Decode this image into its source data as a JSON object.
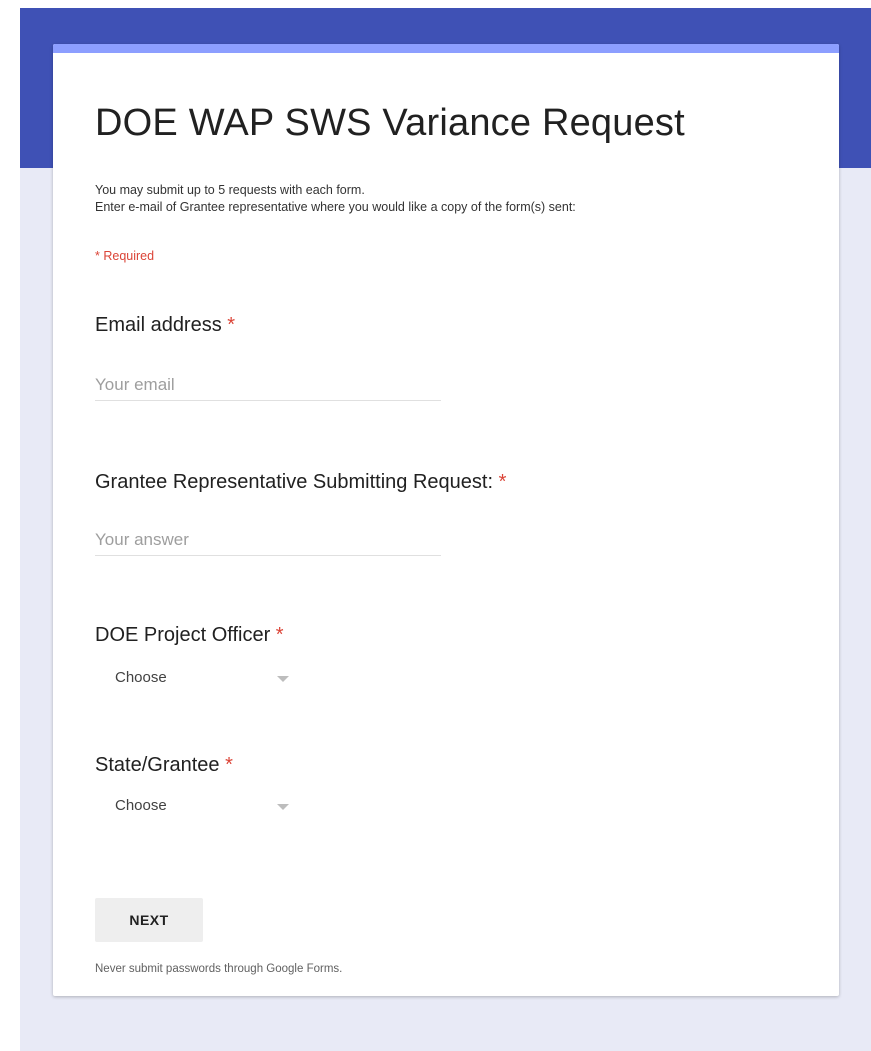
{
  "theme": {
    "header_color": "#3f51b5",
    "card_accent": "#8c9eff",
    "page_background": "#e8eaf6",
    "required_color": "#db4437"
  },
  "form": {
    "title": "DOE WAP SWS Variance Request",
    "description_lines": [
      "You may submit up to 5 requests with each form.",
      "Enter e-mail of Grantee representative where you would like a copy of the form(s) sent:"
    ],
    "required_note": "* Required",
    "required_marker": "*",
    "questions": {
      "email": {
        "label": "Email address",
        "placeholder": "Your email"
      },
      "grantee_rep": {
        "label": "Grantee Representative Submitting Request:",
        "placeholder": "Your answer"
      },
      "project_officer": {
        "label": "DOE Project Officer",
        "selected": "Choose",
        "icon": "dropdown-caret-icon"
      },
      "state_grantee": {
        "label": "State/Grantee",
        "selected": "Choose",
        "icon": "dropdown-caret-icon"
      }
    },
    "next_label": "NEXT",
    "footer_note": "Never submit passwords through Google Forms."
  }
}
